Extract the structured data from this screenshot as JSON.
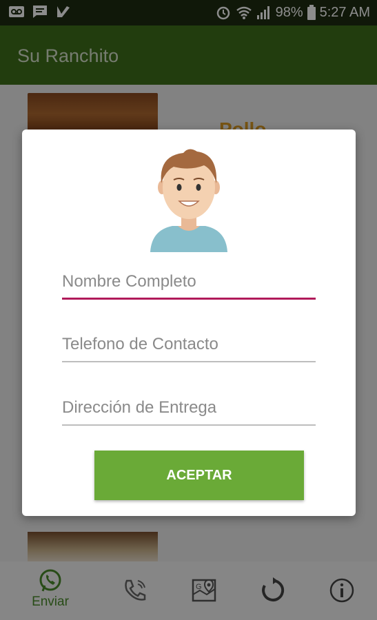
{
  "status_bar": {
    "left_icons": [
      "voicemail-icon",
      "message-icon",
      "checkmark-app-icon"
    ],
    "battery": "98%",
    "time": "5:27 AM",
    "icons": [
      "alarm-icon",
      "wifi-icon",
      "signal-icon",
      "battery-icon"
    ]
  },
  "app_bar": {
    "title": "Su Ranchito"
  },
  "background_content": {
    "item_title": "Pollo"
  },
  "dialog": {
    "avatar": "user-avatar-icon",
    "fields": {
      "name_placeholder": "Nombre Completo",
      "phone_placeholder": "Telefono de Contacto",
      "address_placeholder": "Dirección de Entrega"
    },
    "accept_label": "ACEPTAR"
  },
  "bottom_nav": {
    "items": [
      {
        "icon": "whatsapp-icon",
        "label": "Enviar"
      },
      {
        "icon": "phone-icon"
      },
      {
        "icon": "map-icon"
      },
      {
        "icon": "refresh-icon"
      },
      {
        "icon": "info-icon"
      }
    ]
  },
  "colors": {
    "app_bar": "#3f6f1a",
    "status_bar": "#1e2d12",
    "accent": "#b01a5a",
    "button": "#6aaa37"
  }
}
